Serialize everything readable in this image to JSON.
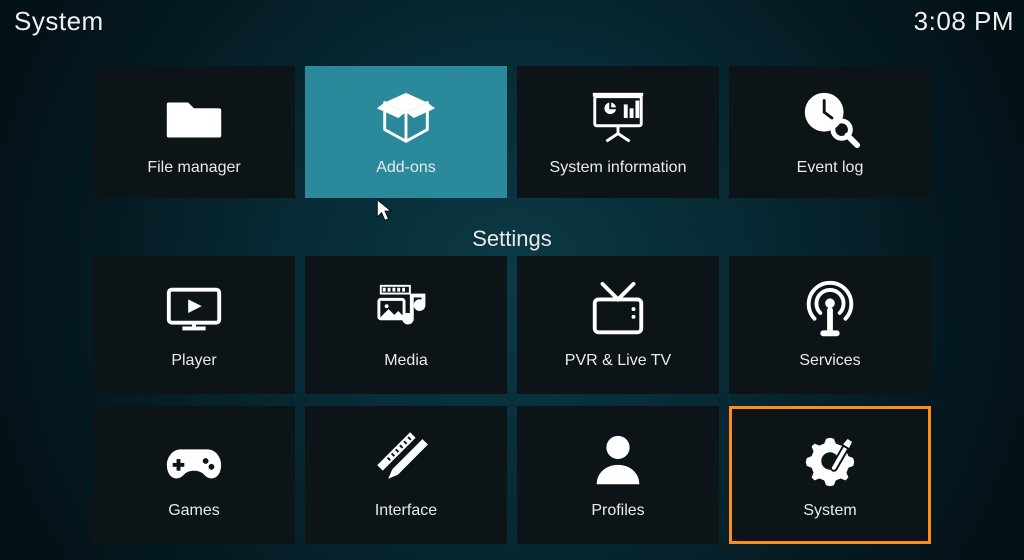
{
  "header": {
    "title": "System",
    "clock": "3:08 PM"
  },
  "top_row": [
    {
      "name": "file-manager",
      "label": "File manager",
      "icon": "folder"
    },
    {
      "name": "add-ons",
      "label": "Add-ons",
      "icon": "open-box",
      "hover": true
    },
    {
      "name": "system-info",
      "label": "System information",
      "icon": "presentation-chart"
    },
    {
      "name": "event-log",
      "label": "Event log",
      "icon": "clock-search"
    }
  ],
  "settings_heading": "Settings",
  "settings_row1": [
    {
      "name": "player",
      "label": "Player",
      "icon": "monitor-play"
    },
    {
      "name": "media",
      "label": "Media",
      "icon": "media-collection"
    },
    {
      "name": "pvr",
      "label": "PVR & Live TV",
      "icon": "tv-antenna"
    },
    {
      "name": "services",
      "label": "Services",
      "icon": "broadcast"
    }
  ],
  "settings_row2": [
    {
      "name": "games",
      "label": "Games",
      "icon": "gamepad"
    },
    {
      "name": "interface",
      "label": "Interface",
      "icon": "pencil-ruler"
    },
    {
      "name": "profiles",
      "label": "Profiles",
      "icon": "person"
    },
    {
      "name": "system",
      "label": "System",
      "icon": "gear-tool",
      "highlight": true
    }
  ]
}
